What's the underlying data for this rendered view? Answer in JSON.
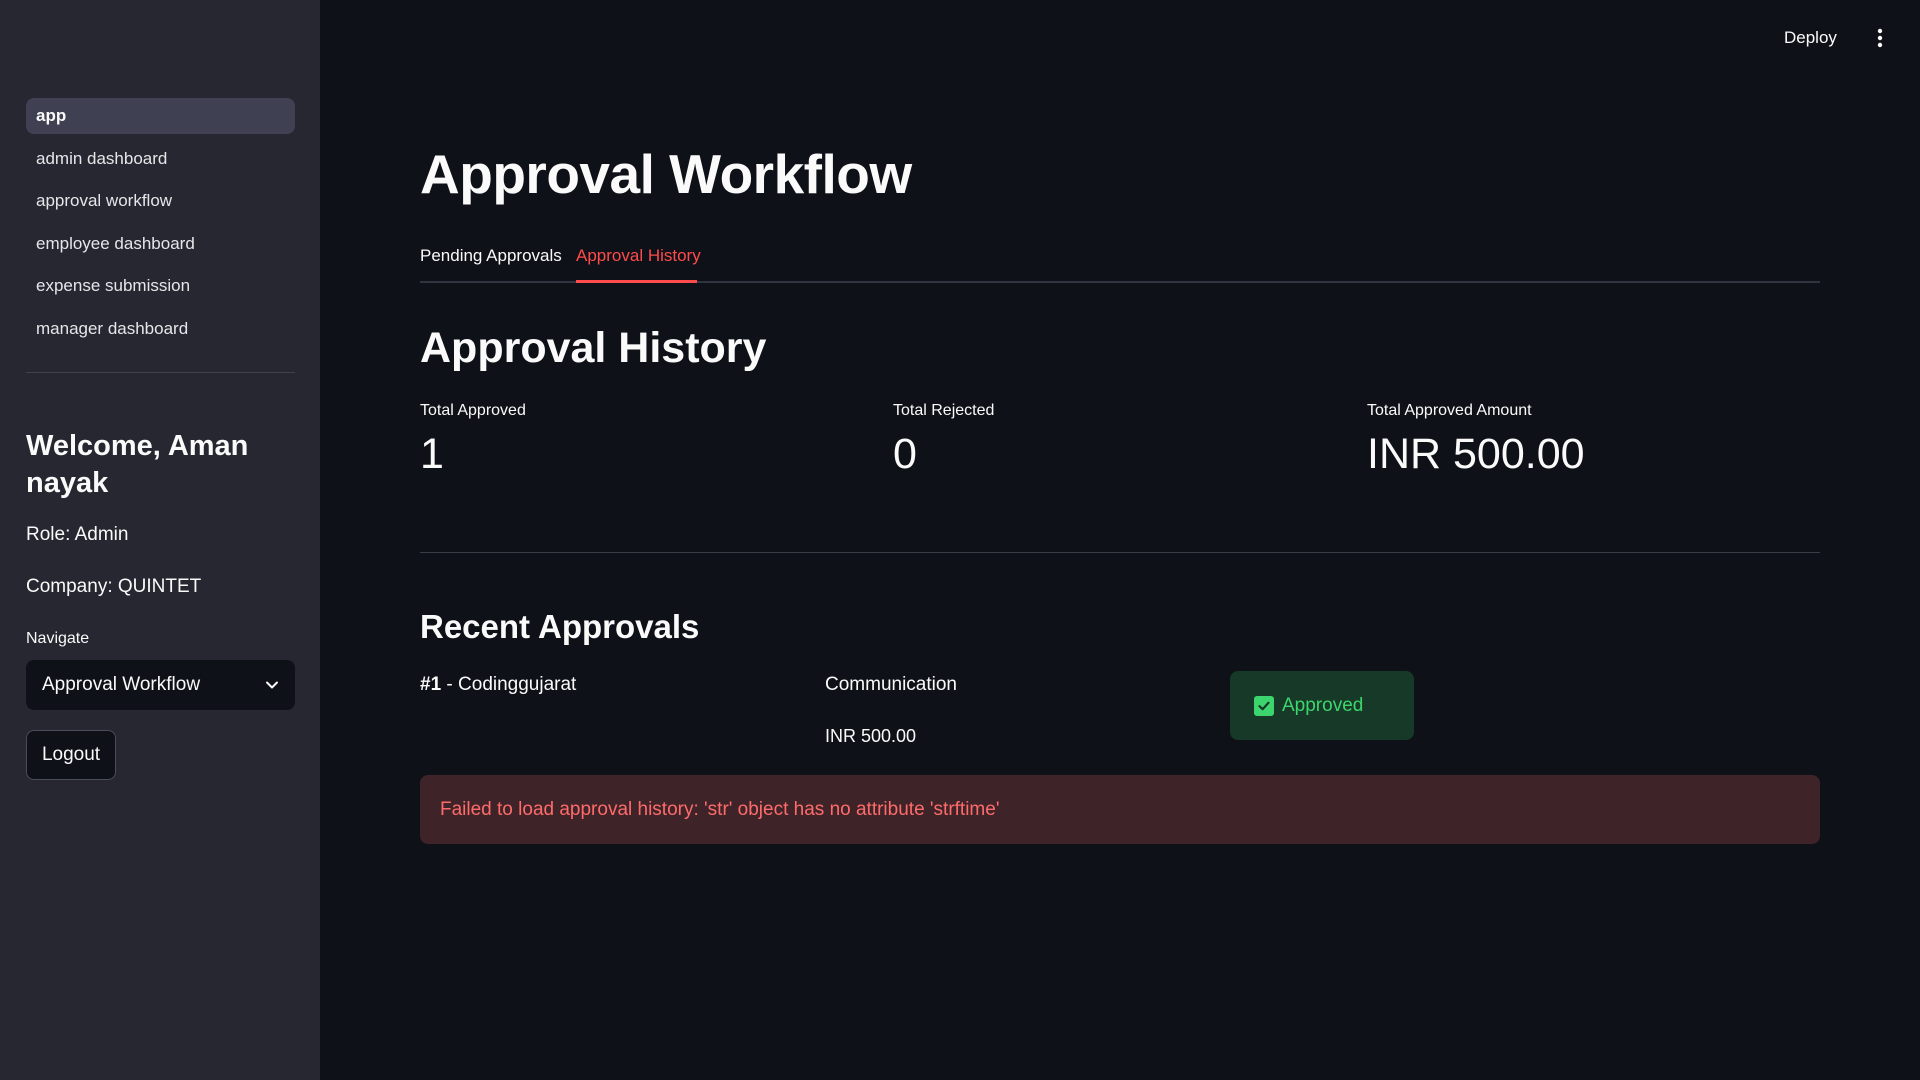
{
  "header": {
    "deploy_label": "Deploy",
    "menu_icon": "kebab-menu-icon"
  },
  "sidebar": {
    "nav_items": [
      {
        "label": "app",
        "active": true
      },
      {
        "label": "admin dashboard",
        "active": false
      },
      {
        "label": "approval workflow",
        "active": false
      },
      {
        "label": "employee dashboard",
        "active": false
      },
      {
        "label": "expense submission",
        "active": false
      },
      {
        "label": "manager dashboard",
        "active": false
      }
    ],
    "welcome": "Welcome, Aman nayak",
    "role": "Role: Admin",
    "company": "Company: QUINTET",
    "navigate_label": "Navigate",
    "navigate_selected": "Approval Workflow",
    "logout_label": "Logout"
  },
  "main": {
    "title": "Approval Workflow",
    "tabs": [
      {
        "label": "Pending Approvals",
        "active": false
      },
      {
        "label": "Approval History",
        "active": true
      }
    ],
    "section_title": "Approval History",
    "metrics": [
      {
        "label": "Total Approved",
        "value": "1"
      },
      {
        "label": "Total Rejected",
        "value": "0"
      },
      {
        "label": "Total Approved Amount",
        "value": "INR 500.00"
      }
    ],
    "recent_title": "Recent Approvals",
    "approvals": [
      {
        "id": "#1",
        "name": "- Codinggujarat",
        "category": "Communication",
        "amount": "INR 500.00",
        "status": "Approved"
      }
    ],
    "error_message": "Failed to load approval history: 'str' object has no attribute 'strftime'"
  },
  "colors": {
    "background": "#0e1117",
    "sidebar": "#262730",
    "accent": "#ff4b4b",
    "success": "#3dd56d",
    "error_bg": "#3e2428"
  }
}
